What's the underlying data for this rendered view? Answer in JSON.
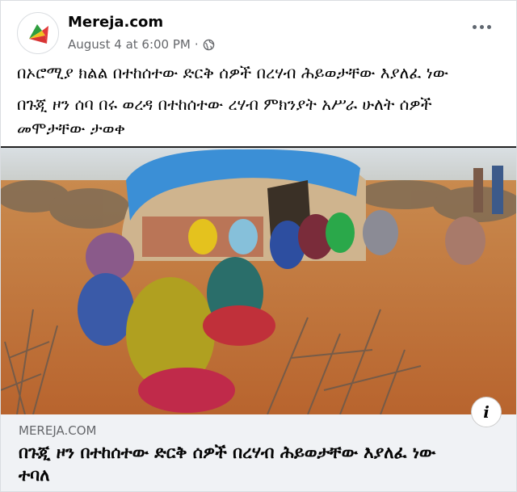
{
  "post": {
    "page_name": "Mereja.com",
    "date": "August 4 at 6:00 PM",
    "separator": "·",
    "paragraphs": [
      "በኦሮሚያ ክልል በተከሰተው ድርቅ ሰዎች በረሃብ ሕይወታቸው እያለፈ ነው",
      "በጉጂ ዞን ሰባ በሩ ወረዳ በተከሰተው ረሃብ ምክንያት አሥራ ሁለት ሰዎች መሞታቸው ታወቀ"
    ]
  },
  "link": {
    "domain": "MEREJA.COM",
    "title": "በጉጂ ዞን በተከሰተው ድርቅ ሰዎች በረሃብ ሕይወታቸው እያለፈ ነው ተባለ"
  },
  "icons": {
    "avatar": "mereja-logo-icon",
    "privacy": "globe-icon",
    "menu": "more-options-icon",
    "info": "info-icon"
  },
  "colors": {
    "text_primary": "#050505",
    "text_secondary": "#65676b",
    "preview_bg": "#f0f2f5"
  }
}
